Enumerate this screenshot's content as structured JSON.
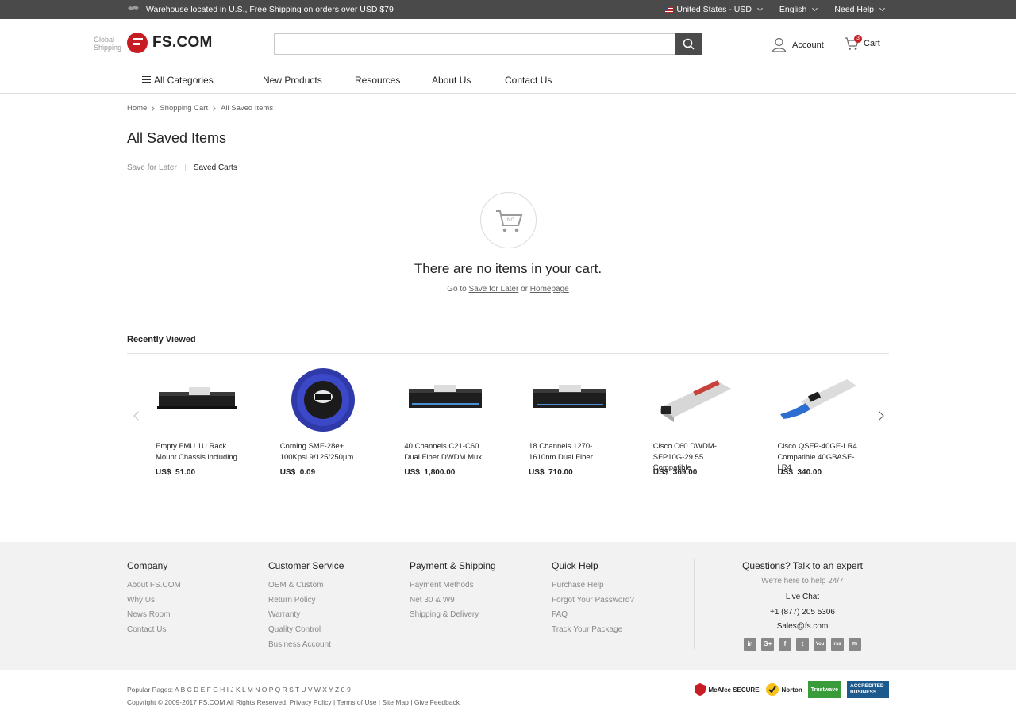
{
  "topbar": {
    "notice": "Warehouse located in U.S., Free Shipping on orders over USD $79",
    "region": "United States - USD",
    "language": "English",
    "help": "Need Help"
  },
  "header": {
    "logo_text": "FS.COM",
    "logo_tagline": "Global Shipping",
    "search_placeholder": "",
    "account_label": "Account",
    "cart_label": "Cart",
    "cart_count": "3"
  },
  "nav": {
    "all_categories": "All Categories",
    "new_products": "New Products",
    "resources": "Resources",
    "about_us": "About Us",
    "contact_us": "Contact Us"
  },
  "breadcrumb": [
    "Home",
    "Shopping Cart",
    "All  Saved Items"
  ],
  "page_title": "All Saved Items",
  "tabs": {
    "save_for_later": "Save for Later",
    "saved_carts": "Saved Carts"
  },
  "empty": {
    "icon_label": "NO",
    "message": "There are no items in your cart.",
    "prefix": "Go to",
    "link1": "Save for Later",
    "joiner": "or",
    "link2": "Homepage"
  },
  "recently_viewed": {
    "title": "Recently Viewed",
    "products": [
      {
        "name": "Empty FMU 1U Rack Mount Chassis including",
        "currency": "US$",
        "price": "51.00",
        "image": "rack-chassis"
      },
      {
        "name": "Corning SMF-28e+ 100Kpsi 9/125/250μm",
        "currency": "US$",
        "price": "0.09",
        "image": "fiber-spool"
      },
      {
        "name": "40 Channels C21-C60 Dual Fiber DWDM Mux",
        "currency": "US$",
        "price": "1,800.00",
        "image": "rack-mux"
      },
      {
        "name": "18 Channels 1270-1610nm Dual Fiber",
        "currency": "US$",
        "price": "710.00",
        "image": "rack-mux"
      },
      {
        "name": "Cisco C60 DWDM-SFP10G-29.55 Compatible",
        "currency": "US$",
        "price": "369.00",
        "image": "sfp-module"
      },
      {
        "name": "Cisco QSFP-40GE-LR4 Compatible 40GBASE-LR4",
        "currency": "US$",
        "price": "340.00",
        "image": "qsfp-module"
      }
    ]
  },
  "footer": {
    "company": {
      "title": "Company",
      "links": [
        "About FS.COM",
        "Why Us",
        "News Room",
        "Contact Us"
      ]
    },
    "customer_service": {
      "title": "Customer Service",
      "links": [
        "OEM & Custom",
        "Return Policy",
        "Warranty",
        "Quality Control",
        "Business Account"
      ]
    },
    "payment_shipping": {
      "title": "Payment & Shipping",
      "links": [
        "Payment Methods",
        "Net 30 & W9",
        "Shipping & Delivery"
      ]
    },
    "quick_help": {
      "title": "Quick Help",
      "links": [
        "Purchase Help",
        "Forgot Your Password?",
        "FAQ",
        "Track Your Package"
      ]
    },
    "expert": {
      "title": "Questions? Talk to an expert",
      "subtitle": "We're here to help 24/7",
      "live_chat": "Live Chat",
      "phone": "+1 (877) 205 5306",
      "email": "Sales@fs.com",
      "socials": [
        "in",
        "G+",
        "f",
        "t",
        "You",
        "rss",
        "m"
      ]
    }
  },
  "bottom": {
    "popular_pages": "Popular Pages: A  B  C  D  E  F  G  H  I  J  K  L  M  N  O  P  Q  R  S  T  U  V  W  X  Y  Z  0-9",
    "copyright": "Copyright © 2009-2017 FS.COM All Rights Reserved. Privacy Policy | Terms of Use | Site Map | Give Feedback",
    "badges": [
      "McAfee SECURE",
      "Norton",
      "Trustwave",
      "ACCREDITED BUSINESS"
    ]
  },
  "colors": {
    "brand_red": "#c81c23",
    "topbar": "#4a4a4a",
    "footer_bg": "#f2f2f2"
  }
}
